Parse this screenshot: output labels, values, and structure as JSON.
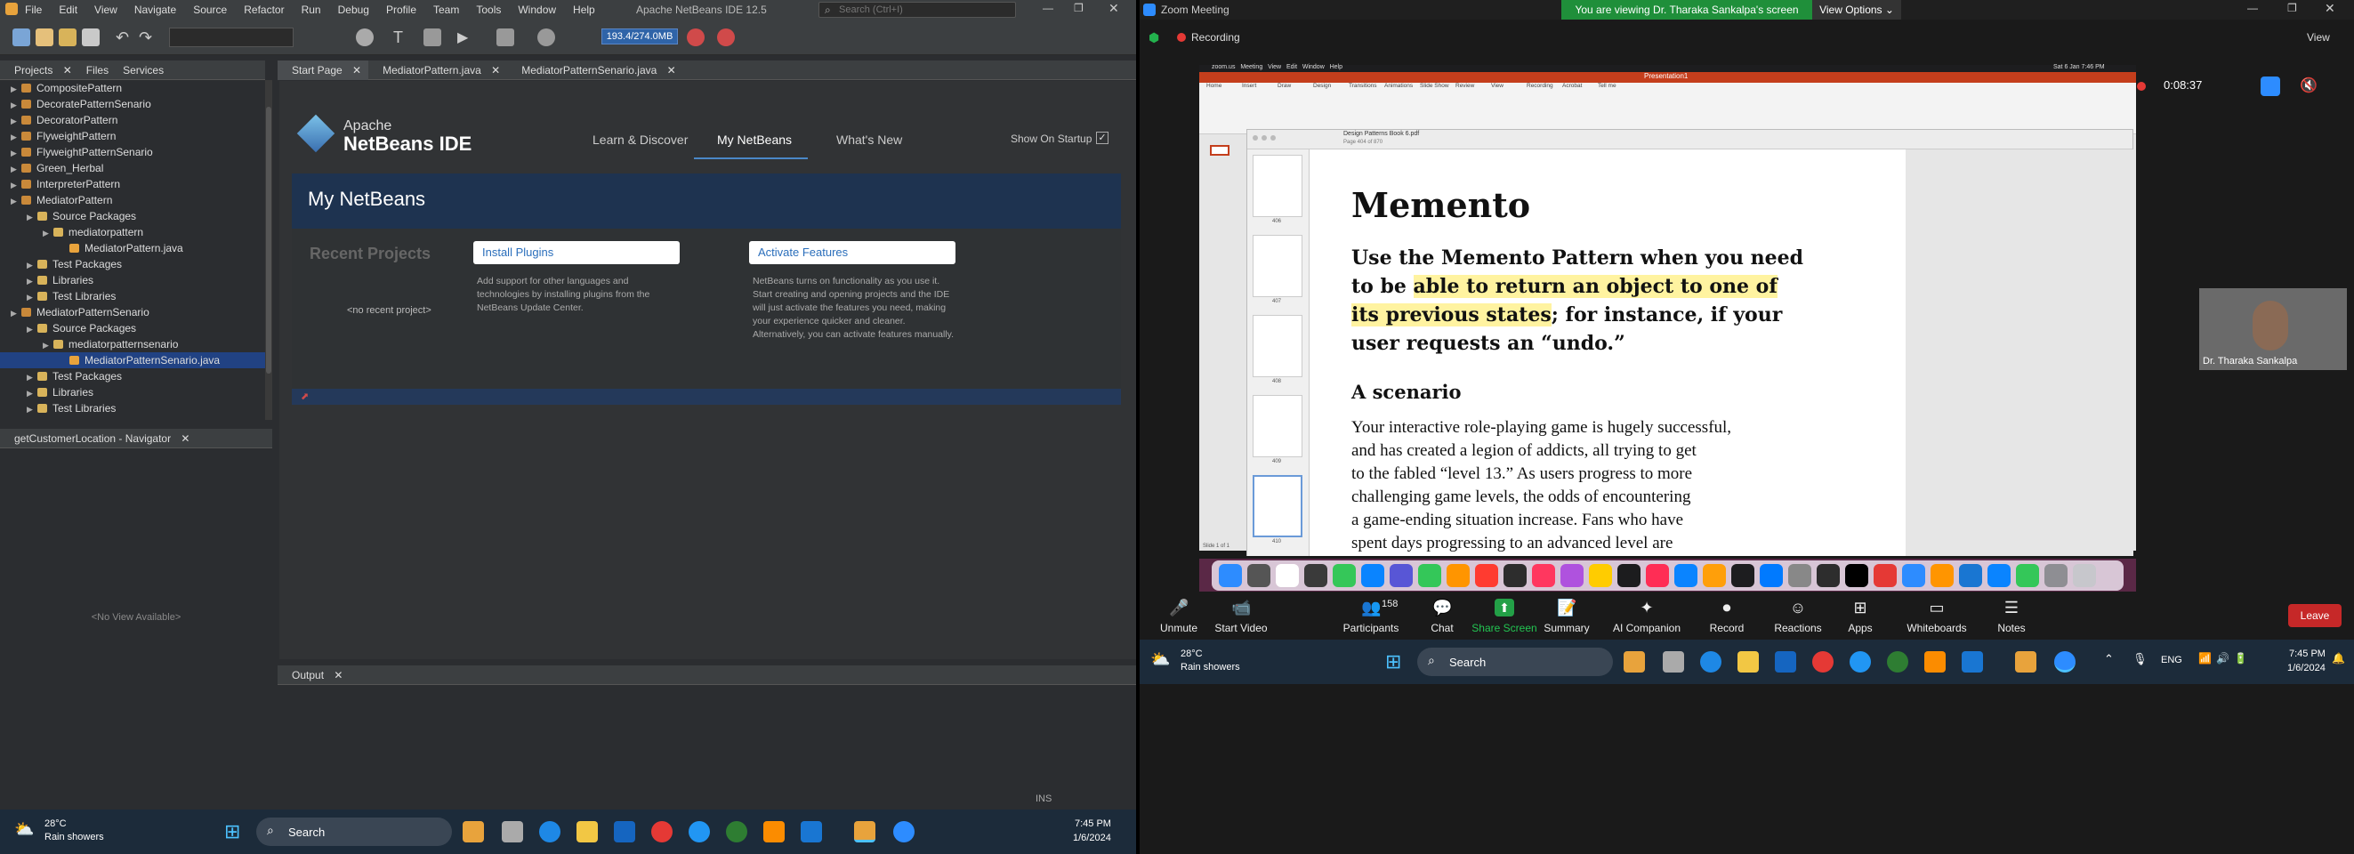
{
  "netbeans": {
    "title": "Apache NetBeans IDE 12.5",
    "menu": [
      "File",
      "Edit",
      "View",
      "Navigate",
      "Source",
      "Refactor",
      "Run",
      "Debug",
      "Profile",
      "Team",
      "Tools",
      "Window",
      "Help"
    ],
    "search_placeholder": "Search (Ctrl+I)",
    "memory": "193.4/274.0MB",
    "panel_tabs": [
      "Projects",
      "Files",
      "Services"
    ],
    "tree": [
      {
        "label": "CompositePattern",
        "indent": 0,
        "type": "project"
      },
      {
        "label": "DecoratePatternSenario",
        "indent": 0,
        "type": "project"
      },
      {
        "label": "DecoratorPattern",
        "indent": 0,
        "type": "project"
      },
      {
        "label": "FlyweightPattern",
        "indent": 0,
        "type": "project"
      },
      {
        "label": "FlyweightPatternSenario",
        "indent": 0,
        "type": "project"
      },
      {
        "label": "Green_Herbal",
        "indent": 0,
        "type": "project"
      },
      {
        "label": "InterpreterPattern",
        "indent": 0,
        "type": "project"
      },
      {
        "label": "MediatorPattern",
        "indent": 0,
        "type": "project"
      },
      {
        "label": "Source Packages",
        "indent": 1,
        "type": "folder"
      },
      {
        "label": "mediatorpattern",
        "indent": 2,
        "type": "package"
      },
      {
        "label": "MediatorPattern.java",
        "indent": 3,
        "type": "file"
      },
      {
        "label": "Test Packages",
        "indent": 1,
        "type": "folder"
      },
      {
        "label": "Libraries",
        "indent": 1,
        "type": "folder"
      },
      {
        "label": "Test Libraries",
        "indent": 1,
        "type": "folder"
      },
      {
        "label": "MediatorPatternSenario",
        "indent": 0,
        "type": "project"
      },
      {
        "label": "Source Packages",
        "indent": 1,
        "type": "folder"
      },
      {
        "label": "mediatorpatternsenario",
        "indent": 2,
        "type": "package"
      },
      {
        "label": "MediatorPatternSenario.java",
        "indent": 3,
        "type": "file",
        "selected": true
      },
      {
        "label": "Test Packages",
        "indent": 1,
        "type": "folder"
      },
      {
        "label": "Libraries",
        "indent": 1,
        "type": "folder"
      },
      {
        "label": "Test Libraries",
        "indent": 1,
        "type": "folder"
      }
    ],
    "navigator_title": "getCustomerLocation - Navigator",
    "no_view": "<No View Available>",
    "editor_tabs": [
      "Start Page",
      "MediatorPattern.java",
      "MediatorPatternSenario.java"
    ],
    "start": {
      "logo_top": "Apache",
      "logo_bottom": "NetBeans IDE",
      "nav": [
        "Learn & Discover",
        "My NetBeans",
        "What's New"
      ],
      "show_on_startup": "Show On Startup",
      "heading": "My NetBeans",
      "recent_title": "Recent Projects",
      "no_recent": "<no recent project>",
      "install_plugins": "Install Plugins",
      "install_text": "Add support for other languages and technologies by installing plugins from the NetBeans Update Center.",
      "activate_features": "Activate Features",
      "activate_text": "NetBeans turns on functionality as you use it. Start creating and opening projects and the IDE will just activate the features you need, making your experience quicker and cleaner. Alternatively, you can activate features manually."
    },
    "output_tab": "Output",
    "ins": "INS",
    "taskbar": {
      "weather_temp": "28°C",
      "weather_desc": "Rain showers",
      "search": "Search",
      "time": "7:45 PM",
      "date": "1/6/2024"
    }
  },
  "zoom": {
    "title": "Zoom Meeting",
    "viewing_banner": "You are viewing Dr. Tharaka Sankalpa's screen",
    "view_options": "View Options",
    "recording": "Recording",
    "view": "View",
    "timer": "0:08:37",
    "participant_name": "Dr. Tharaka Sankalpa",
    "controls": [
      {
        "label": "Unmute",
        "icon": "🎤"
      },
      {
        "label": "Start Video",
        "icon": "📹"
      },
      {
        "label": "Participants",
        "icon": "👥",
        "count": "158"
      },
      {
        "label": "Chat",
        "icon": "💬"
      },
      {
        "label": "Share Screen",
        "icon": "⬆"
      },
      {
        "label": "Summary",
        "icon": "📝"
      },
      {
        "label": "AI Companion",
        "icon": "✦"
      },
      {
        "label": "Record",
        "icon": "⏺"
      },
      {
        "label": "Reactions",
        "icon": "☺"
      },
      {
        "label": "Apps",
        "icon": "⊞"
      },
      {
        "label": "Whiteboards",
        "icon": "▭"
      },
      {
        "label": "Notes",
        "icon": "☰"
      }
    ],
    "leave": "Leave",
    "taskbar": {
      "weather_temp": "28°C",
      "weather_desc": "Rain showers",
      "search": "Search",
      "lang": "ENG",
      "time": "7:45 PM",
      "date": "1/6/2024"
    }
  },
  "mac": {
    "menu": [
      "zoom.us",
      "Meeting",
      "View",
      "Edit",
      "Window",
      "Help"
    ],
    "datetime": "Sat 6 Jan 7:46 PM",
    "doc_title": "Presentation1",
    "ribbon_tabs": [
      "Home",
      "Insert",
      "Draw",
      "Design",
      "Transitions",
      "Animations",
      "Slide Show",
      "Review",
      "View",
      "Recording",
      "Acrobat",
      "Tell me"
    ],
    "pdf_title": "Design Patterns Book 6.pdf",
    "pdf_subtitle": "Page 404 of 870",
    "thumb_pages": [
      "406",
      "407",
      "408",
      "409",
      "410"
    ],
    "slide_status": "Slide 1 of 1"
  },
  "book": {
    "title": "Memento",
    "intro_pre": "Use the Memento Pattern when you need to be ",
    "intro_highlight": "able to return an object to one of its previous states",
    "intro_post": "; for instance, if your user requests an “undo.”",
    "scenario_title": "A scenario",
    "scenario_lines": [
      "Your interactive role-playing game is hugely successful,",
      "and has created a legion of addicts, all trying to get",
      "to the fabled “level 13.” As users progress to more",
      "challenging game levels, the odds of encountering",
      "a game-ending situation increase. Fans who have",
      "spent days progressing to an advanced level are"
    ]
  },
  "colors": {
    "highlight": "#fff3a0",
    "zoom_green": "#1f8f3a",
    "leave_red": "#c62828",
    "nb_blue": "#1e3350",
    "selection": "#214283"
  }
}
